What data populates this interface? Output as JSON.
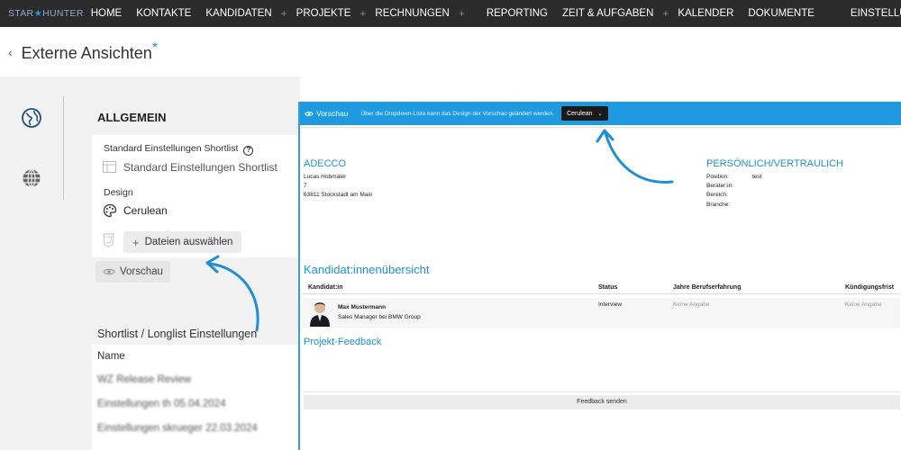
{
  "nav": {
    "logo_part1": "STAR",
    "logo_part2": "HUNTER",
    "items": [
      "HOME",
      "KONTAKTE",
      "KANDIDATEN",
      "PROJEKTE",
      "RECHNUNGEN",
      "REPORTING",
      "ZEIT & AUFGABEN",
      "KALENDER",
      "DOKUMENTE",
      "EINSTELLUNGEN"
    ],
    "plus": "+"
  },
  "header": {
    "title": "Externe Ansichten",
    "star": "*"
  },
  "settings": {
    "section_title": "ALLGEMEIN",
    "standard_label": "Standard Einstellungen Shortlist",
    "standard_value": "Standard Einstellungen Shortlist",
    "design_label": "Design",
    "design_value": "Cerulean",
    "upload_label": "Dateien auswählen",
    "preview_label": "Vorschau"
  },
  "shortlist": {
    "title": "Shortlist / Longlist Einstellungen",
    "column": "Name",
    "rows": [
      "WZ Release Review",
      "Einstellungen th 05.04.2024",
      "Einstellungen skrueger 22.03.2024"
    ]
  },
  "preview": {
    "bar_title": "Vorschau",
    "hint": "Über die Dropdown-Liste kann das Design der Vorschau geändert werden.",
    "select_value": "Cerulean",
    "company": {
      "name": "ADECCO",
      "contact": "Lucas Hobmaier",
      "line2": "7",
      "address": "63811 Stockstadt am Main"
    },
    "confidential": {
      "title": "PERSÖNLICH/VERTRAULICH",
      "fields": [
        {
          "label": "Position:",
          "value": "test"
        },
        {
          "label": "Berater:in:",
          "value": ""
        },
        {
          "label": "Bereich:",
          "value": ""
        },
        {
          "label": "Branche:",
          "value": ""
        }
      ]
    },
    "candidates_title": "Kandidat:innenübersicht",
    "table_headers": [
      "Kandidat:in",
      "Status",
      "Jahre Berufserfahrung",
      "Kündigungsfrist"
    ],
    "candidate": {
      "name": "Max Mustermann",
      "role": "Sales Manager bei BMW Group",
      "status": "Interview",
      "experience": "Keine Angabe",
      "notice": "Keine Angabe"
    },
    "feedback_title": "Projekt-Feedback",
    "feedback_button": "Feedback senden"
  },
  "colors": {
    "accent": "#1e9ae0",
    "nav_bg": "#2b2b2b",
    "arrow": "#1e8fd6"
  }
}
